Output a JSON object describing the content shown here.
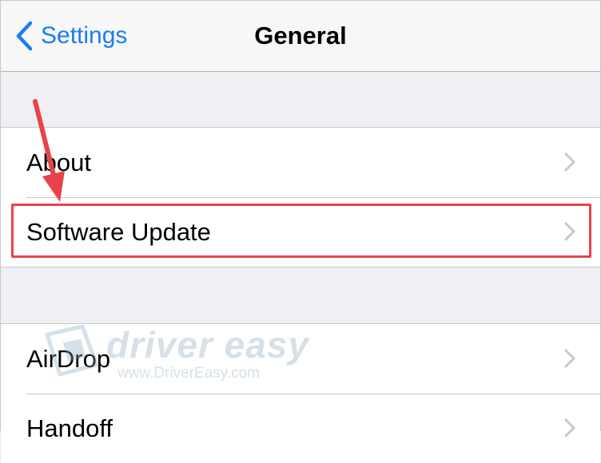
{
  "navbar": {
    "back_label": "Settings",
    "title": "General"
  },
  "groups": [
    {
      "rows": [
        {
          "label": "About"
        },
        {
          "label": "Software Update"
        }
      ]
    },
    {
      "rows": [
        {
          "label": "AirDrop"
        },
        {
          "label": "Handoff"
        }
      ]
    }
  ],
  "watermark": {
    "brand": "driver easy",
    "url": "www.DriverEasy.com"
  },
  "colors": {
    "accent": "#1a7cf5",
    "annotation": "#e8434b",
    "background": "#efeff4"
  },
  "icons": {
    "back": "chevron-left-icon",
    "row": "chevron-right-icon",
    "annotation": "red-arrow-icon"
  }
}
